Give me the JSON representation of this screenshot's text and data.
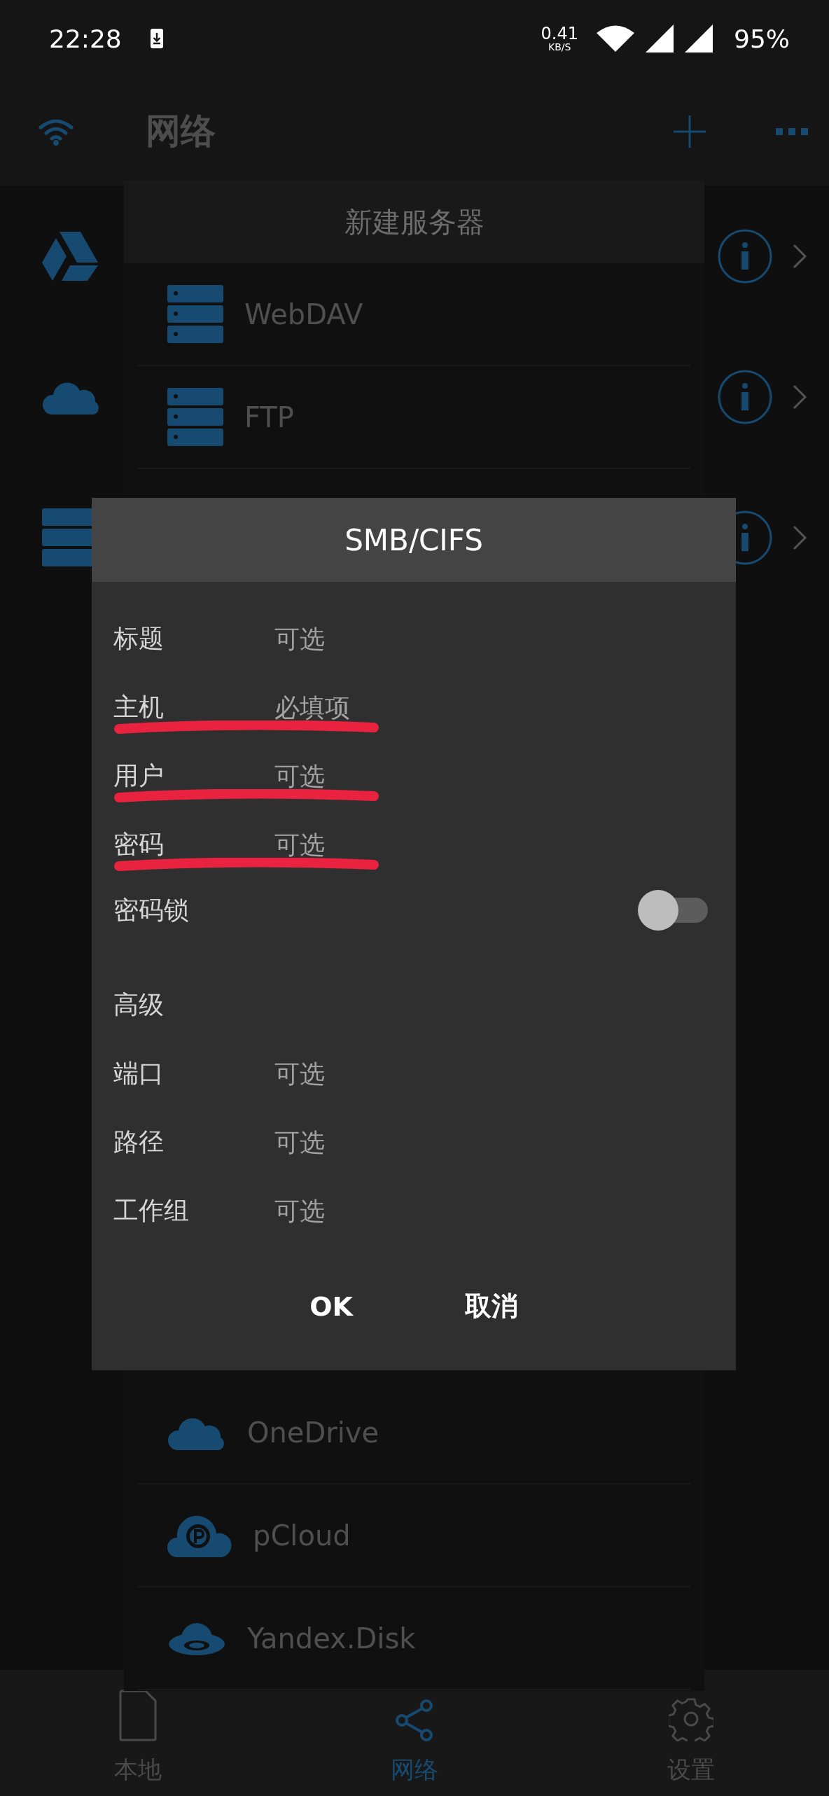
{
  "status_bar": {
    "time": "22:28",
    "speed": "0.41",
    "speed_unit": "KB/S",
    "battery": "95%"
  },
  "app_bar": {
    "title": "网络"
  },
  "sheet": {
    "title": "新建服务器",
    "items_top": [
      {
        "label": "WebDAV",
        "kind": "server"
      },
      {
        "label": "FTP",
        "kind": "server"
      }
    ],
    "items_bottom": [
      {
        "label": "OneDrive",
        "kind": "cloud"
      },
      {
        "label": "pCloud",
        "kind": "pcloud"
      },
      {
        "label": "Yandex.Disk",
        "kind": "yandex"
      }
    ]
  },
  "background_rows": [
    {
      "kind": "drive"
    },
    {
      "kind": "cloud"
    },
    {
      "kind": "server"
    }
  ],
  "dialog": {
    "title": "SMB/CIFS",
    "fields": [
      {
        "kind": "field",
        "label": "标题",
        "placeholder": "可选",
        "marked": false
      },
      {
        "kind": "field",
        "label": "主机",
        "placeholder": "必填项",
        "marked": true
      },
      {
        "kind": "field",
        "label": "用户",
        "placeholder": "可选",
        "marked": true
      },
      {
        "kind": "field",
        "label": "密码",
        "placeholder": "可选",
        "marked": true
      },
      {
        "kind": "toggle",
        "label": "密码锁",
        "on": false
      },
      {
        "kind": "section",
        "label": "高级"
      },
      {
        "kind": "field",
        "label": "端口",
        "placeholder": "可选",
        "marked": false
      },
      {
        "kind": "field",
        "label": "路径",
        "placeholder": "可选",
        "marked": false
      },
      {
        "kind": "field",
        "label": "工作组",
        "placeholder": "可选",
        "marked": false
      }
    ],
    "buttons": [
      "OK",
      "取消"
    ]
  },
  "bottom_nav": [
    {
      "label": "本地",
      "kind": "file",
      "selected": false
    },
    {
      "label": "网络",
      "kind": "share",
      "selected": true
    },
    {
      "label": "设置",
      "kind": "gear",
      "selected": false
    }
  ]
}
